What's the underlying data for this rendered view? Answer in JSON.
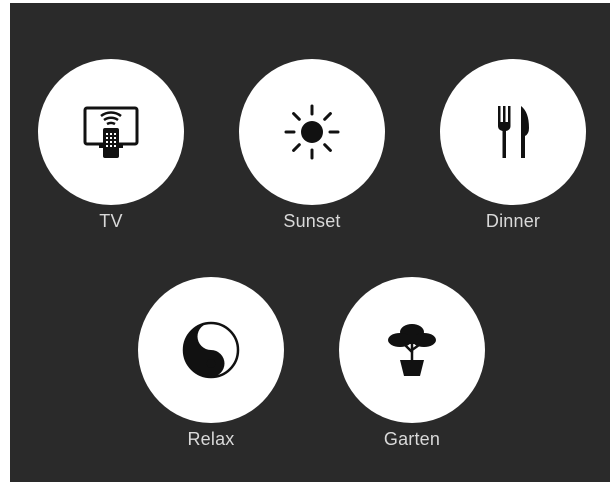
{
  "colors": {
    "background": "#2a2a2a",
    "circle": "#ffffff",
    "icon": "#111111",
    "label": "#d9d9d9"
  },
  "scenes": [
    {
      "label": "TV",
      "icon": "tv-remote-icon"
    },
    {
      "label": "Sunset",
      "icon": "sun-icon"
    },
    {
      "label": "Dinner",
      "icon": "fork-knife-icon"
    },
    {
      "label": "Relax",
      "icon": "yin-yang-icon"
    },
    {
      "label": "Garten",
      "icon": "potted-tree-icon"
    }
  ]
}
